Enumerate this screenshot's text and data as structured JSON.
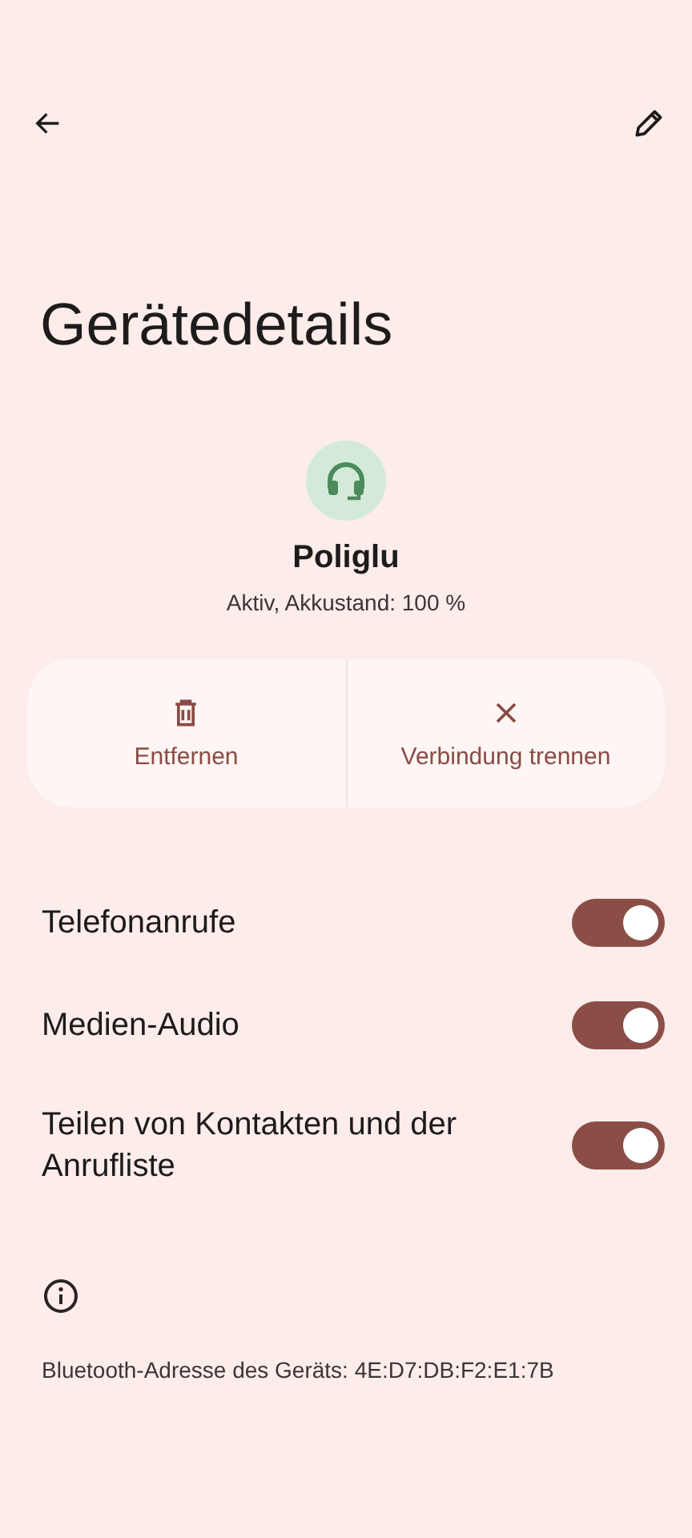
{
  "title": "Gerätedetails",
  "device": {
    "name": "Poliglu",
    "status": "Aktiv, Akkustand: 100 %"
  },
  "actions": [
    {
      "kind": "delete",
      "label": "Entfernen"
    },
    {
      "kind": "disconnect",
      "label": "Verbindung trennen"
    }
  ],
  "settings": [
    {
      "label": "Telefonanrufe",
      "on": true
    },
    {
      "label": "Medien-Audio",
      "on": true
    },
    {
      "label": "Teilen von Kontakten und der Anrufliste",
      "on": true
    }
  ],
  "footer": {
    "address": "Bluetooth-Adresse des Geräts: 4E:D7:DB:F2:E1:7B"
  }
}
